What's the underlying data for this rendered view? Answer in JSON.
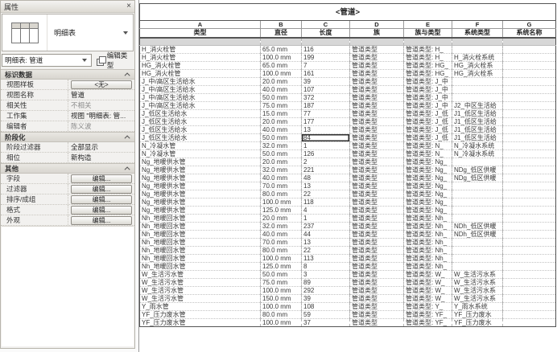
{
  "properties_panel": {
    "title": "属性",
    "close_glyph": "×",
    "type_selector_label": "明细表",
    "instance_combo_value": "明细表: 管道",
    "edit_type_label": "编辑类型",
    "sections": [
      {
        "title": "标识数据",
        "rows": [
          {
            "label": "视图样板",
            "value": "<无>",
            "kind": "button"
          },
          {
            "label": "视图名称",
            "value": "管道",
            "kind": "text"
          },
          {
            "label": "相关性",
            "value": "不相关",
            "kind": "text",
            "muted": true
          },
          {
            "label": "工作集",
            "value": "视图 \"明细表: 管...",
            "kind": "text"
          },
          {
            "label": "编辑者",
            "value": "陈义波",
            "kind": "text",
            "muted": true
          }
        ]
      },
      {
        "title": "阶段化",
        "rows": [
          {
            "label": "阶段过滤器",
            "value": "全部显示",
            "kind": "text"
          },
          {
            "label": "相位",
            "value": "新构造",
            "kind": "text"
          }
        ]
      },
      {
        "title": "其他",
        "rows": [
          {
            "label": "字段",
            "value": "编辑...",
            "kind": "button"
          },
          {
            "label": "过滤器",
            "value": "编辑...",
            "kind": "button"
          },
          {
            "label": "排序/成组",
            "value": "编辑...",
            "kind": "button"
          },
          {
            "label": "格式",
            "value": "编辑...",
            "kind": "button"
          },
          {
            "label": "外观",
            "value": "编辑...",
            "kind": "button"
          }
        ]
      }
    ]
  },
  "schedule": {
    "title": "<管道>",
    "column_letters": [
      "A",
      "B",
      "C",
      "D",
      "E",
      "F",
      "G"
    ],
    "headers": [
      "类型",
      "直径",
      "长度",
      "族",
      "族与类型",
      "系统类型",
      "系统名称"
    ],
    "selected_cell": {
      "row": 11,
      "col": 2
    },
    "rows": [
      [
        "H_消火栓管",
        "65.0 mm",
        "116",
        "管道类型",
        "管道类型: H_",
        "",
        ""
      ],
      [
        "H_消火栓管",
        "100.0 mm",
        "199",
        "管道类型",
        "管道类型: H_",
        "H_消火栓系统",
        ""
      ],
      [
        "HG_消火栓管",
        "65.0 mm",
        "7",
        "管道类型",
        "管道类型: HG_",
        "HG_消火栓系",
        ""
      ],
      [
        "HG_消火栓管",
        "100.0 mm",
        "161",
        "管道类型",
        "管道类型: HG_",
        "HG_消火栓系",
        ""
      ],
      [
        "J_中/高区生活给水",
        "20.0 mm",
        "39",
        "管道类型",
        "管道类型: J_中",
        "",
        ""
      ],
      [
        "J_中/高区生活给水",
        "40.0 mm",
        "107",
        "管道类型",
        "管道类型: J_中",
        "",
        ""
      ],
      [
        "J_中/高区生活给水",
        "50.0 mm",
        "372",
        "管道类型",
        "管道类型: J_中",
        "",
        ""
      ],
      [
        "J_中/高区生活给水",
        "75.0 mm",
        "187",
        "管道类型",
        "管道类型: J_中",
        "J2_中区生活给",
        ""
      ],
      [
        "J_低区生活给水",
        "15.0 mm",
        "77",
        "管道类型",
        "管道类型: J_低",
        "J1_低区生活给",
        ""
      ],
      [
        "J_低区生活给水",
        "20.0 mm",
        "177",
        "管道类型",
        "管道类型: J_低",
        "J1_低区生活给",
        ""
      ],
      [
        "J_低区生活给水",
        "40.0 mm",
        "13",
        "管道类型",
        "管道类型: J_低",
        "J1_低区生活给",
        ""
      ],
      [
        "J_低区生活给水",
        "50.0 mm",
        "84",
        "管道类型",
        "管道类型: J_低",
        "J1_低区生活给",
        ""
      ],
      [
        "N_冷凝水管",
        "32.0 mm",
        "1",
        "管道类型",
        "管道类型: N_",
        "N_冷凝水系统",
        ""
      ],
      [
        "N_冷凝水管",
        "50.0 mm",
        "126",
        "管道类型",
        "管道类型: N_",
        "N_冷凝水系统",
        ""
      ],
      [
        "Ng_地暖供水管",
        "20.0 mm",
        "2",
        "管道类型",
        "管道类型: Ng_",
        "",
        ""
      ],
      [
        "Ng_地暖供水管",
        "32.0 mm",
        "221",
        "管道类型",
        "管道类型: Ng_",
        "NDg_低区供暖",
        ""
      ],
      [
        "Ng_地暖供水管",
        "40.0 mm",
        "48",
        "管道类型",
        "管道类型: Ng_",
        "NDg_低区供暖",
        ""
      ],
      [
        "Ng_地暖供水管",
        "70.0 mm",
        "13",
        "管道类型",
        "管道类型: Ng_",
        "",
        ""
      ],
      [
        "Ng_地暖供水管",
        "80.0 mm",
        "22",
        "管道类型",
        "管道类型: Ng_",
        "",
        ""
      ],
      [
        "Ng_地暖供水管",
        "100.0 mm",
        "118",
        "管道类型",
        "管道类型: Ng_",
        "",
        ""
      ],
      [
        "Ng_地暖供水管",
        "125.0 mm",
        "4",
        "管道类型",
        "管道类型: Ng_",
        "",
        ""
      ],
      [
        "Nh_地暖回水管",
        "20.0 mm",
        "1",
        "管道类型",
        "管道类型: Nh_",
        "",
        ""
      ],
      [
        "Nh_地暖回水管",
        "32.0 mm",
        "237",
        "管道类型",
        "管道类型: Nh_",
        "NDh_低区供暖",
        ""
      ],
      [
        "Nh_地暖回水管",
        "40.0 mm",
        "44",
        "管道类型",
        "管道类型: Nh_",
        "NDh_低区供暖",
        ""
      ],
      [
        "Nh_地暖回水管",
        "70.0 mm",
        "13",
        "管道类型",
        "管道类型: Nh_",
        "",
        ""
      ],
      [
        "Nh_地暖回水管",
        "80.0 mm",
        "22",
        "管道类型",
        "管道类型: Nh_",
        "",
        ""
      ],
      [
        "Nh_地暖回水管",
        "100.0 mm",
        "113",
        "管道类型",
        "管道类型: Nh_",
        "",
        ""
      ],
      [
        "Nh_地暖回水管",
        "125.0 mm",
        "8",
        "管道类型",
        "管道类型: Nh_",
        "",
        ""
      ],
      [
        "W_生活污水管",
        "50.0 mm",
        "3",
        "管道类型",
        "管道类型: W_",
        "W_生活污水系",
        ""
      ],
      [
        "W_生活污水管",
        "75.0 mm",
        "89",
        "管道类型",
        "管道类型: W_",
        "W_生活污水系",
        ""
      ],
      [
        "W_生活污水管",
        "100.0 mm",
        "292",
        "管道类型",
        "管道类型: W_",
        "W_生活污水系",
        ""
      ],
      [
        "W_生活污水管",
        "150.0 mm",
        "39",
        "管道类型",
        "管道类型: W_",
        "W_生活污水系",
        ""
      ],
      [
        "Y_雨水管",
        "100.0 mm",
        "108",
        "管道类型",
        "管道类型: Y_",
        "Y_雨水系统",
        ""
      ],
      [
        "YF_压力废水管",
        "80.0 mm",
        "59",
        "管道类型",
        "管道类型: YF_",
        "YF_压力废水",
        ""
      ],
      [
        "YF_压力废水管",
        "100.0 mm",
        "37",
        "管道类型",
        "管道类型: YF_",
        "YF_压力废水",
        ""
      ]
    ]
  }
}
